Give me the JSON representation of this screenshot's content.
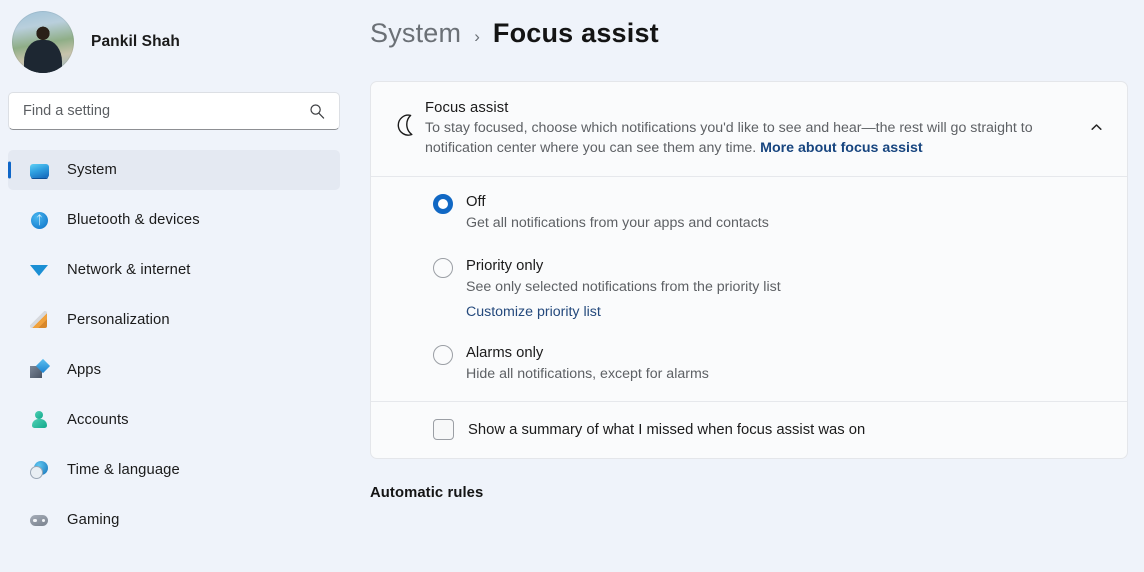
{
  "sidebar": {
    "profile": {
      "name": "Pankil Shah",
      "avatar_alt": "user-avatar"
    },
    "search": {
      "placeholder": "Find a setting",
      "value": "",
      "icon": "search-icon"
    },
    "items": [
      {
        "label": "System",
        "icon": "monitor-icon",
        "selected": true
      },
      {
        "label": "Bluetooth & devices",
        "icon": "bluetooth-icon",
        "selected": false
      },
      {
        "label": "Network & internet",
        "icon": "wifi-icon",
        "selected": false
      },
      {
        "label": "Personalization",
        "icon": "brush-icon",
        "selected": false
      },
      {
        "label": "Apps",
        "icon": "apps-icon",
        "selected": false
      },
      {
        "label": "Accounts",
        "icon": "account-icon",
        "selected": false
      },
      {
        "label": "Time & language",
        "icon": "clock-icon",
        "selected": false
      },
      {
        "label": "Gaming",
        "icon": "gamepad-icon",
        "selected": false
      }
    ]
  },
  "breadcrumb": {
    "parent": "System",
    "separator": "›",
    "current": "Focus assist"
  },
  "card": {
    "icon": "moon-icon",
    "title": "Focus assist",
    "description": "To stay focused, choose which notifications you'd like to see and hear—the rest will go straight to notification center where you can see them any time.",
    "link_label": "More about focus assist",
    "collapse_icon": "chevron-up-icon"
  },
  "options": [
    {
      "label": "Off",
      "description": "Get all notifications from your apps and contacts",
      "selected": true,
      "link": ""
    },
    {
      "label": "Priority only",
      "description": "See only selected notifications from the priority list",
      "selected": false,
      "link": "Customize priority list"
    },
    {
      "label": "Alarms only",
      "description": "Hide all notifications, except for alarms",
      "selected": false,
      "link": ""
    }
  ],
  "summary_checkbox": {
    "label": "Show a summary of what I missed when focus assist was on",
    "checked": false
  },
  "automatic_rules": {
    "title": "Automatic rules"
  },
  "colors": {
    "accent": "#1168c4",
    "selected_indicator": "#0f66c8",
    "page_background": "#eff3fa",
    "card_background": "#fafbfc",
    "link": "#17457f"
  }
}
